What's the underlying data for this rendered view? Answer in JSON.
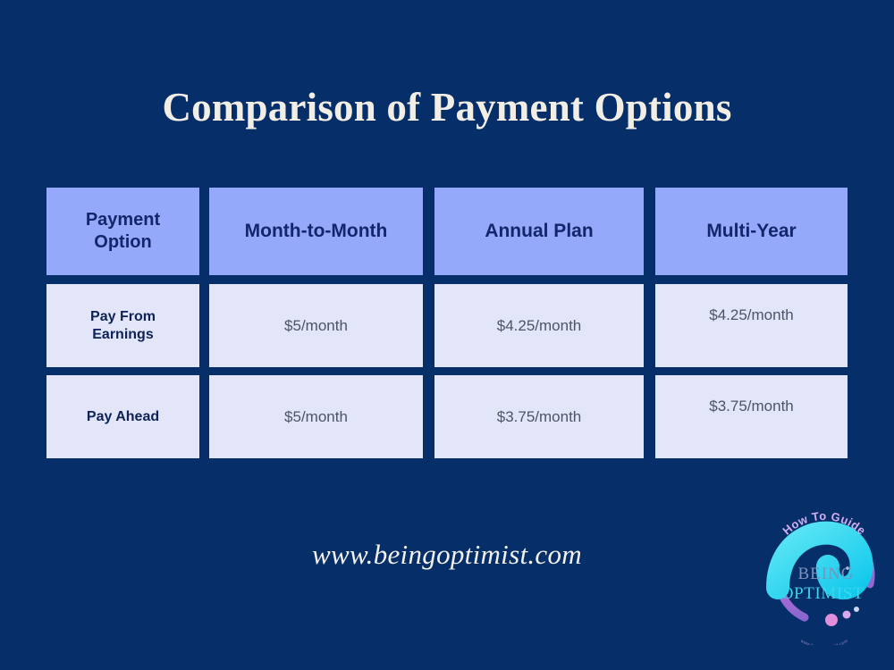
{
  "slide": {
    "background_color": "#062e68",
    "title": "Comparison of Payment Options",
    "url": "www.beingoptimist.com"
  },
  "table": {
    "headers": [
      "Payment Option",
      "Month-to-Month",
      "Annual Plan",
      "Multi-Year"
    ],
    "header_line1": "Payment",
    "header_line2": "Option",
    "rows": [
      {
        "label_line1": "Pay From",
        "label_line2": "Earnings",
        "label": "Pay From Earnings",
        "month_to_month": "$5/month",
        "annual_plan": "$4.25/month",
        "multi_year": "$4.25/month"
      },
      {
        "label_line1": "Pay Ahead",
        "label_line2": "",
        "label": "Pay Ahead",
        "month_to_month": "$5/month",
        "annual_plan": "$3.75/month",
        "multi_year": "$3.75/month"
      }
    ],
    "colors": {
      "header_fill": "#95a9fa",
      "header_text": "#14266b",
      "body_fill": "#e2e6f8",
      "label_text": "#0e2257",
      "value_text": "#4c5566"
    }
  },
  "logo": {
    "tagline": "How To Guide",
    "brand_line1": "BEING",
    "brand_line2": "OPTIMIST",
    "footer_text": "www.beingoptimist.com",
    "colors": {
      "swoosh_cyan": "#2fe0f2",
      "ring_purple": "#b06fd6",
      "ring_pink": "#e08fd8",
      "tagline": "#d2aef0",
      "brand_line1": "#7d93bb",
      "brand_line2": "#3fd4e8"
    }
  },
  "chart_data": {
    "type": "table",
    "title": "Comparison of Payment Options",
    "columns": [
      "Payment Option",
      "Month-to-Month",
      "Annual Plan",
      "Multi-Year"
    ],
    "rows": [
      [
        "Pay From Earnings",
        "$5/month",
        "$4.25/month",
        "$4.25/month"
      ],
      [
        "Pay Ahead",
        "$5/month",
        "$3.75/month",
        "$3.75/month"
      ]
    ],
    "numeric_values": {
      "Pay From Earnings": {
        "Month-to-Month": 5.0,
        "Annual Plan": 4.25,
        "Multi-Year": 4.25
      },
      "Pay Ahead": {
        "Month-to-Month": 5.0,
        "Annual Plan": 3.75,
        "Multi-Year": 3.75
      }
    },
    "unit": "USD per month"
  }
}
